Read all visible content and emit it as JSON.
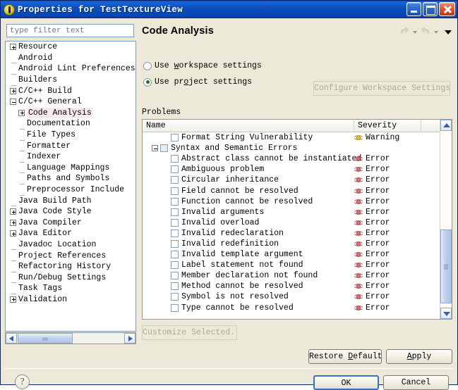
{
  "window": {
    "title": "Properties for TestTextureView",
    "icon": "eclipse-properties-icon",
    "buttons": {
      "minimize": "minimize-icon",
      "maximize": "maximize-icon",
      "close": "close-icon"
    }
  },
  "sidebar": {
    "filter_placeholder": "type filter text",
    "filter_value": "",
    "items": [
      {
        "label": "Resource",
        "depth": 0,
        "twist": "plus",
        "selected": false
      },
      {
        "label": "Android",
        "depth": 0,
        "twist": "none",
        "selected": false
      },
      {
        "label": "Android Lint Preferences",
        "depth": 0,
        "twist": "none",
        "selected": false
      },
      {
        "label": "Builders",
        "depth": 0,
        "twist": "none",
        "selected": false
      },
      {
        "label": "C/C++ Build",
        "depth": 0,
        "twist": "plus",
        "selected": false
      },
      {
        "label": "C/C++ General",
        "depth": 0,
        "twist": "minus",
        "selected": false
      },
      {
        "label": "Code Analysis",
        "depth": 1,
        "twist": "plus",
        "selected": true
      },
      {
        "label": "Documentation",
        "depth": 1,
        "twist": "none",
        "selected": false
      },
      {
        "label": "File Types",
        "depth": 1,
        "twist": "none",
        "selected": false
      },
      {
        "label": "Formatter",
        "depth": 1,
        "twist": "none",
        "selected": false
      },
      {
        "label": "Indexer",
        "depth": 1,
        "twist": "none",
        "selected": false
      },
      {
        "label": "Language Mappings",
        "depth": 1,
        "twist": "none",
        "selected": false
      },
      {
        "label": "Paths and Symbols",
        "depth": 1,
        "twist": "none",
        "selected": false
      },
      {
        "label": "Preprocessor Include",
        "depth": 1,
        "twist": "none",
        "selected": false
      },
      {
        "label": "Java Build Path",
        "depth": 0,
        "twist": "none",
        "selected": false
      },
      {
        "label": "Java Code Style",
        "depth": 0,
        "twist": "plus",
        "selected": false
      },
      {
        "label": "Java Compiler",
        "depth": 0,
        "twist": "plus",
        "selected": false
      },
      {
        "label": "Java Editor",
        "depth": 0,
        "twist": "plus",
        "selected": false
      },
      {
        "label": "Javadoc Location",
        "depth": 0,
        "twist": "none",
        "selected": false
      },
      {
        "label": "Project References",
        "depth": 0,
        "twist": "none",
        "selected": false
      },
      {
        "label": "Refactoring History",
        "depth": 0,
        "twist": "none",
        "selected": false
      },
      {
        "label": "Run/Debug Settings",
        "depth": 0,
        "twist": "none",
        "selected": false
      },
      {
        "label": "Task Tags",
        "depth": 0,
        "twist": "none",
        "selected": false
      },
      {
        "label": "Validation",
        "depth": 0,
        "twist": "plus",
        "selected": false
      }
    ]
  },
  "main": {
    "page_title": "Code Analysis",
    "nav": {
      "back_icon": "back-arrow-icon",
      "back_caret": "chevron-down-icon",
      "forward_icon": "forward-arrow-icon",
      "forward_caret": "chevron-down-icon",
      "menu_caret": "view-menu-chevron-down-icon"
    },
    "scope": {
      "workspace_label": "Use workspace settings",
      "workspace_selected": false,
      "project_label": "Use project settings",
      "project_selected": true,
      "configure_label": "Configure Workspace Settings...",
      "configure_enabled": false
    },
    "problems": {
      "group_label": "Problems",
      "columns": [
        "Name",
        "Severity",
        ""
      ],
      "rows": [
        {
          "name": "Format String Vulnerability",
          "severity": "Warning",
          "sev_type": "warn",
          "kind": "child",
          "checked": false
        },
        {
          "name": "Syntax and Semantic Errors",
          "severity": "",
          "sev_type": "",
          "kind": "group",
          "checked": false
        },
        {
          "name": "Abstract class cannot be instantiated",
          "severity": "Error",
          "sev_type": "err",
          "kind": "child",
          "checked": false
        },
        {
          "name": "Ambiguous problem",
          "severity": "Error",
          "sev_type": "err",
          "kind": "child",
          "checked": false
        },
        {
          "name": "Circular inheritance",
          "severity": "Error",
          "sev_type": "err",
          "kind": "child",
          "checked": false
        },
        {
          "name": "Field cannot be resolved",
          "severity": "Error",
          "sev_type": "err",
          "kind": "child",
          "checked": false
        },
        {
          "name": "Function cannot be resolved",
          "severity": "Error",
          "sev_type": "err",
          "kind": "child",
          "checked": false
        },
        {
          "name": "Invalid arguments",
          "severity": "Error",
          "sev_type": "err",
          "kind": "child",
          "checked": false
        },
        {
          "name": "Invalid overload",
          "severity": "Error",
          "sev_type": "err",
          "kind": "child",
          "checked": false
        },
        {
          "name": "Invalid redeclaration",
          "severity": "Error",
          "sev_type": "err",
          "kind": "child",
          "checked": false
        },
        {
          "name": "Invalid redefinition",
          "severity": "Error",
          "sev_type": "err",
          "kind": "child",
          "checked": false
        },
        {
          "name": "Invalid template argument",
          "severity": "Error",
          "sev_type": "err",
          "kind": "child",
          "checked": false
        },
        {
          "name": "Label statement not found",
          "severity": "Error",
          "sev_type": "err",
          "kind": "child",
          "checked": false
        },
        {
          "name": "Member declaration not found",
          "severity": "Error",
          "sev_type": "err",
          "kind": "child",
          "checked": false
        },
        {
          "name": "Method cannot be resolved",
          "severity": "Error",
          "sev_type": "err",
          "kind": "child",
          "checked": false
        },
        {
          "name": "Symbol is not resolved",
          "severity": "Error",
          "sev_type": "err",
          "kind": "child",
          "checked": false
        },
        {
          "name": "Type cannot be resolved",
          "severity": "Error",
          "sev_type": "err",
          "kind": "child",
          "checked": false
        }
      ]
    },
    "customize_label": "Customize Selected...",
    "customize_enabled": false,
    "restore_label": "Restore Defaults",
    "apply_label": "Apply"
  },
  "footer": {
    "help_glyph": "?",
    "ok_label": "OK",
    "cancel_label": "Cancel"
  },
  "colors": {
    "titlebar_blue": "#0a4fc0",
    "dialog_bg": "#ece9d8",
    "error_red": "#e0707d",
    "warning_yellow": "#e8c23a",
    "selection_pink": "#faeaea",
    "default_button_border": "#3c6fc4"
  }
}
